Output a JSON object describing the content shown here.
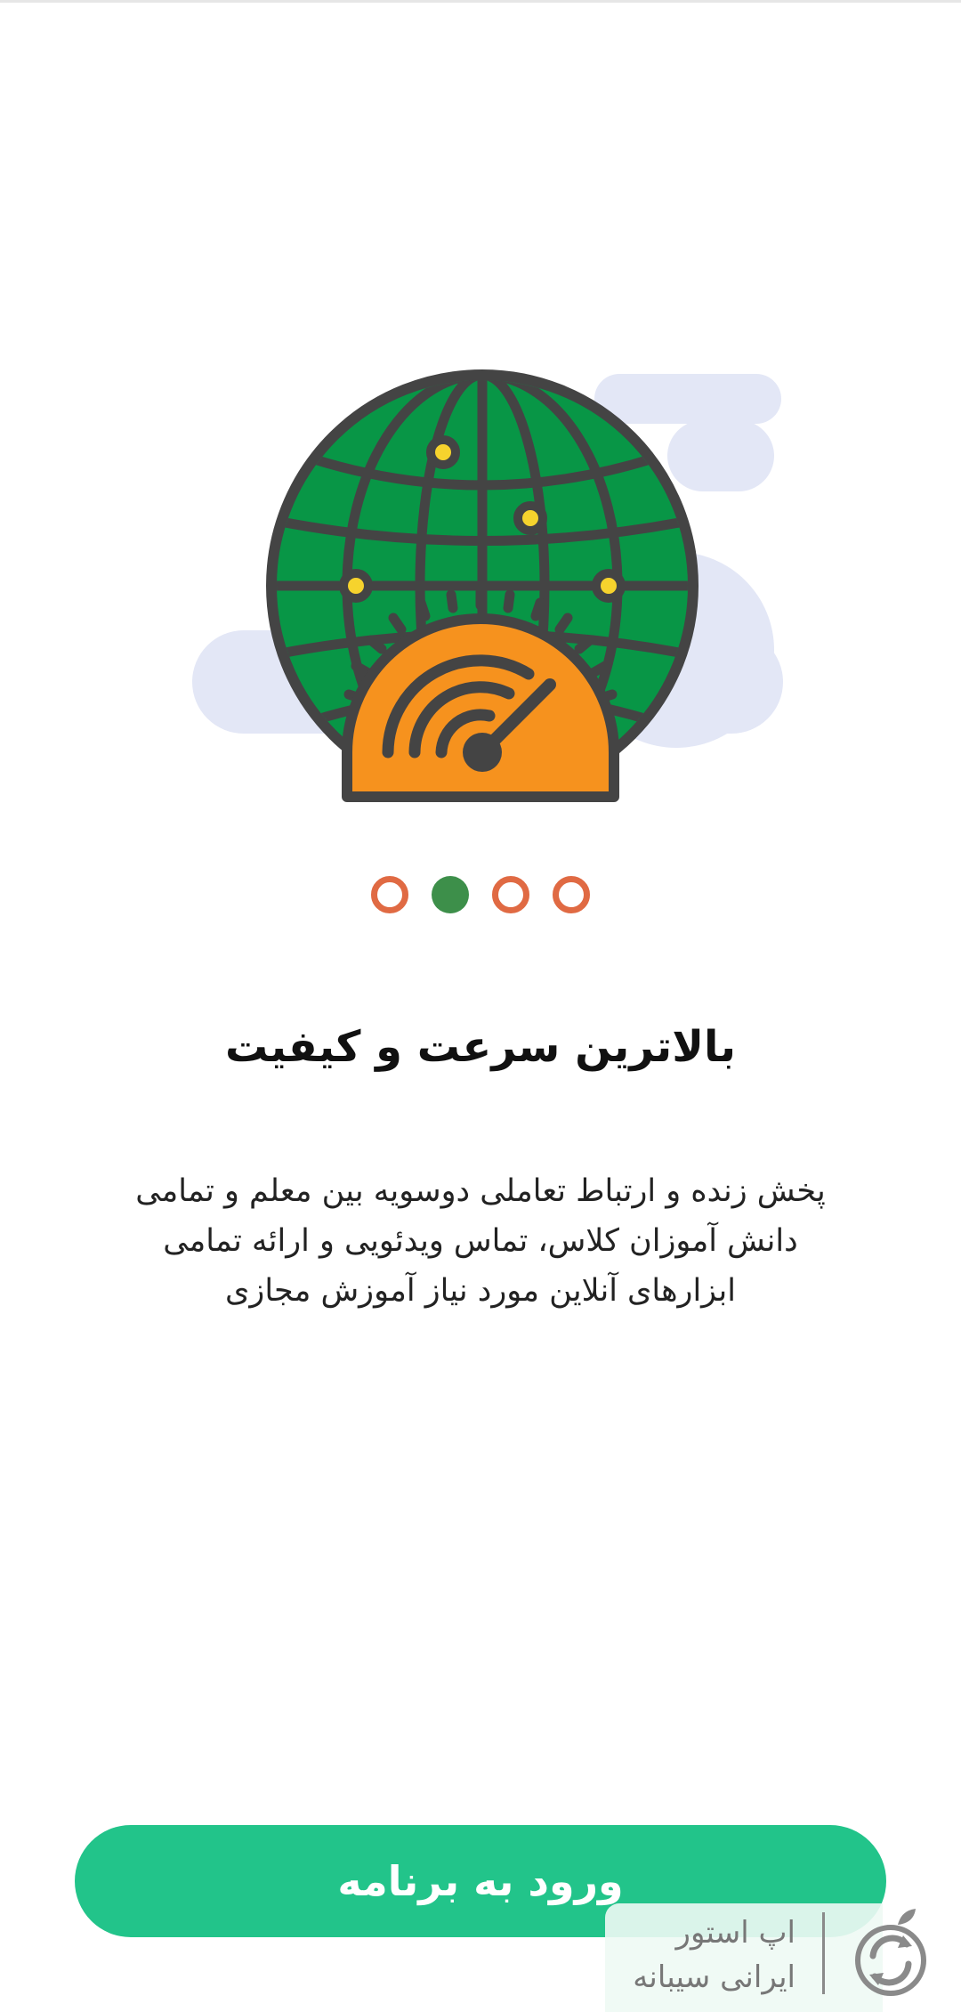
{
  "onboarding": {
    "title": "بالاترین سرعت و کیفیت",
    "description_lines": [
      "پخش زنده و ارتباط تعاملی دوسویه بین معلم و تمامی",
      "دانش آموزان کلاس، تماس ویدئویی و ارائه تمامی",
      "ابزارهای آنلاین مورد نیاز آموزش مجازی"
    ],
    "pager": {
      "total": 4,
      "active_index": 1
    },
    "enter_button_label": "ورود به برنامه",
    "illustration_icon": "globe-speedometer-icon"
  },
  "watermark": {
    "line1": "اپ استور",
    "line2": "ایرانی سیبانه",
    "logo_icon": "apple-sync-logo-icon"
  },
  "colors": {
    "globe_green": "#089646",
    "outline": "#444444",
    "gauge_orange": "#f6921e",
    "cloud": "#e3e7f6",
    "node_yellow": "#f6d32d",
    "dot_orange": "#e06a43",
    "dot_green": "#3d8f4a",
    "button_green": "#22c48a"
  }
}
